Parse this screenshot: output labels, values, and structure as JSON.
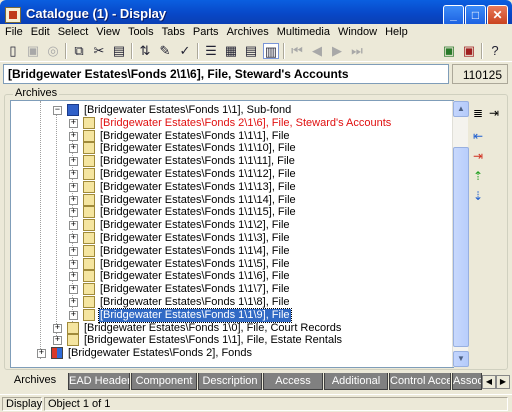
{
  "window": {
    "title": "Catalogue (1) - Display",
    "min_label": "_",
    "max_label": "□",
    "close_label": "✕"
  },
  "menu": [
    "File",
    "Edit",
    "Select",
    "View",
    "Tools",
    "Tabs",
    "Parts",
    "Archives",
    "Multimedia",
    "Window",
    "Help"
  ],
  "path_bar": {
    "path": "[Bridgewater Estates\\Fonds 2\\1\\6], File, Steward's Accounts",
    "record_id": "110125"
  },
  "archives_group": {
    "label": "Archives"
  },
  "tree": [
    {
      "label": "[Bridgewater Estates\\Fonds 1\\1], Sub-fond",
      "expander": "−",
      "type": "subfond"
    },
    {
      "label": "[Bridgewater Estates\\Fonds 2\\1\\6], File, Steward's Accounts",
      "expander": "+",
      "type": "file",
      "state": "red"
    },
    {
      "label": "[Bridgewater Estates\\Fonds 1\\1\\1], File",
      "expander": "+",
      "type": "file"
    },
    {
      "label": "[Bridgewater Estates\\Fonds 1\\1\\10], File",
      "expander": "+",
      "type": "file"
    },
    {
      "label": "[Bridgewater Estates\\Fonds 1\\1\\11], File",
      "expander": "+",
      "type": "file"
    },
    {
      "label": "[Bridgewater Estates\\Fonds 1\\1\\12], File",
      "expander": "+",
      "type": "file"
    },
    {
      "label": "[Bridgewater Estates\\Fonds 1\\1\\13], File",
      "expander": "+",
      "type": "file"
    },
    {
      "label": "[Bridgewater Estates\\Fonds 1\\1\\14], File",
      "expander": "+",
      "type": "file"
    },
    {
      "label": "[Bridgewater Estates\\Fonds 1\\1\\15], File",
      "expander": "+",
      "type": "file"
    },
    {
      "label": "[Bridgewater Estates\\Fonds 1\\1\\2], File",
      "expander": "+",
      "type": "file"
    },
    {
      "label": "[Bridgewater Estates\\Fonds 1\\1\\3], File",
      "expander": "+",
      "type": "file"
    },
    {
      "label": "[Bridgewater Estates\\Fonds 1\\1\\4], File",
      "expander": "+",
      "type": "file"
    },
    {
      "label": "[Bridgewater Estates\\Fonds 1\\1\\5], File",
      "expander": "+",
      "type": "file"
    },
    {
      "label": "[Bridgewater Estates\\Fonds 1\\1\\6], File",
      "expander": "+",
      "type": "file"
    },
    {
      "label": "[Bridgewater Estates\\Fonds 1\\1\\7], File",
      "expander": "+",
      "type": "file"
    },
    {
      "label": "[Bridgewater Estates\\Fonds 1\\1\\8], File",
      "expander": "+",
      "type": "file"
    },
    {
      "label": "[Bridgewater Estates\\Fonds 1\\1\\9], File",
      "expander": "+",
      "type": "file",
      "state": "selected"
    },
    {
      "label": "[Bridgewater Estates\\Fonds 1\\0], File, Court Records",
      "expander": "+",
      "type": "file"
    },
    {
      "label": "[Bridgewater Estates\\Fonds 1\\1], File, Estate Rentals",
      "expander": "+",
      "type": "file"
    },
    {
      "label": "[Bridgewater Estates\\Fonds 2], Fonds",
      "expander": "+",
      "type": "fonds"
    }
  ],
  "tabs": [
    "Archives",
    "EAD Header",
    "Component",
    "Description",
    "Access",
    "Additional",
    "Control Access",
    "Associ"
  ],
  "status": {
    "mode": "Display",
    "position": "Object 1 of 1"
  },
  "colors": {
    "selection": "#316ac5",
    "highlight_text": "#e01010",
    "title_bar": "#0a4fd0"
  },
  "icons": {
    "toolbar": [
      "new-icon",
      "save-icon",
      "disabled-icon",
      "copy-icon",
      "cut-icon",
      "paste-icon",
      "sort-icon",
      "edit-icon",
      "spellcheck-icon",
      "list-icon",
      "grid-icon",
      "report-icon",
      "record-icon",
      "first-icon",
      "prev-icon",
      "next-icon",
      "last-icon",
      "open-window-icon",
      "close-window-icon",
      "context-help-icon"
    ],
    "side": [
      "tree-view-icon",
      "export-icon",
      "move-left-icon",
      "move-right-icon",
      "move-up-icon",
      "move-down-icon"
    ]
  }
}
